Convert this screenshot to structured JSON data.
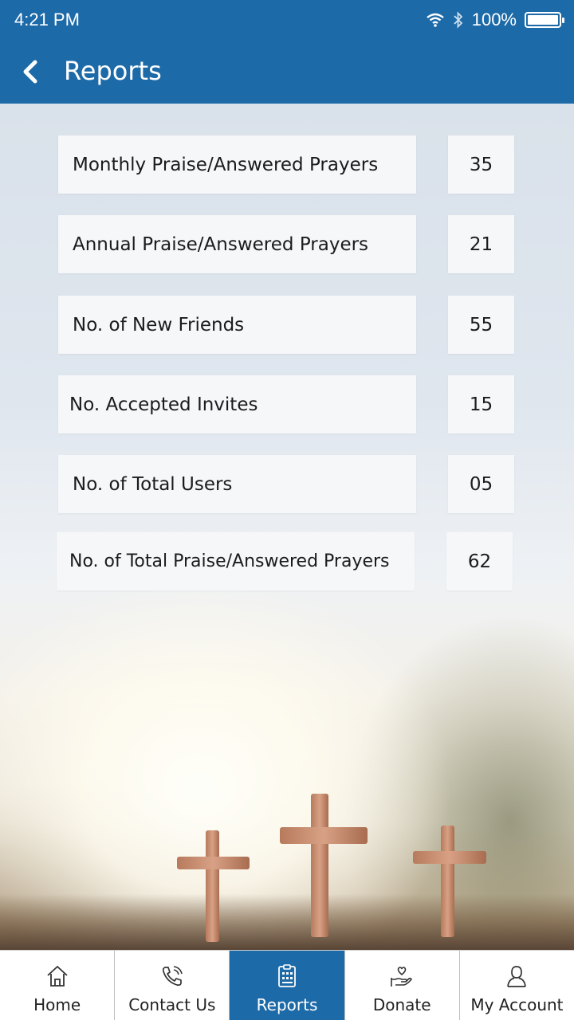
{
  "status_bar": {
    "time": "4:21 PM",
    "battery": "100%"
  },
  "header": {
    "title": "Reports"
  },
  "reports": [
    {
      "label": "Monthly Praise/Answered Prayers",
      "value": "35"
    },
    {
      "label": "Annual Praise/Answered Prayers",
      "value": "21"
    },
    {
      "label": "No. of New Friends",
      "value": "55"
    },
    {
      "label": "No. Accepted Invites",
      "value": "15"
    },
    {
      "label": "No. of Total Users",
      "value": "05"
    },
    {
      "label": "No. of Total Praise/Answered Prayers",
      "value": "62"
    }
  ],
  "nav": {
    "items": [
      {
        "label": "Home",
        "icon": "home-icon"
      },
      {
        "label": "Contact Us",
        "icon": "phone-icon"
      },
      {
        "label": "Reports",
        "icon": "reports-icon",
        "active": true
      },
      {
        "label": "Donate",
        "icon": "donate-hand-heart-icon"
      },
      {
        "label": "My Account",
        "icon": "user-icon"
      }
    ]
  },
  "colors": {
    "primary": "#1d6aa8",
    "card": "#f6f7f9"
  }
}
